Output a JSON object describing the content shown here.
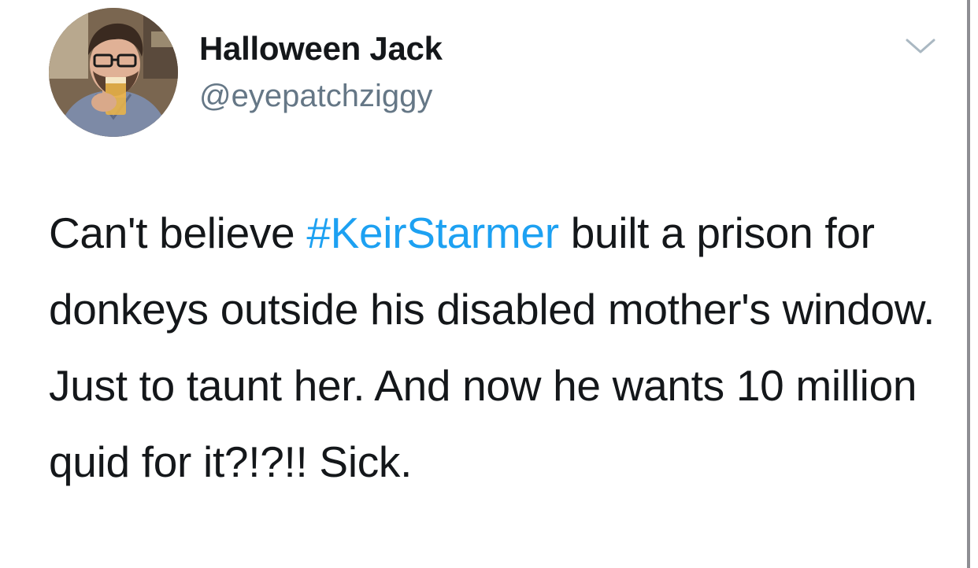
{
  "author": {
    "display_name": "Halloween Jack",
    "handle": "@eyepatchziggy"
  },
  "menu": {
    "icon": "chevron-down-icon"
  },
  "tweet": {
    "text_before": "Can't believe ",
    "hashtag": "#KeirStarmer",
    "text_after": " built a prison for donkeys outside his disabled mother's window. Just to taunt her. And now he wants 10 million quid for it?!?!! Sick."
  },
  "colors": {
    "text": "#14171a",
    "handle": "#657786",
    "hashtag": "#1da1f2",
    "caret": "#aab8c2"
  }
}
